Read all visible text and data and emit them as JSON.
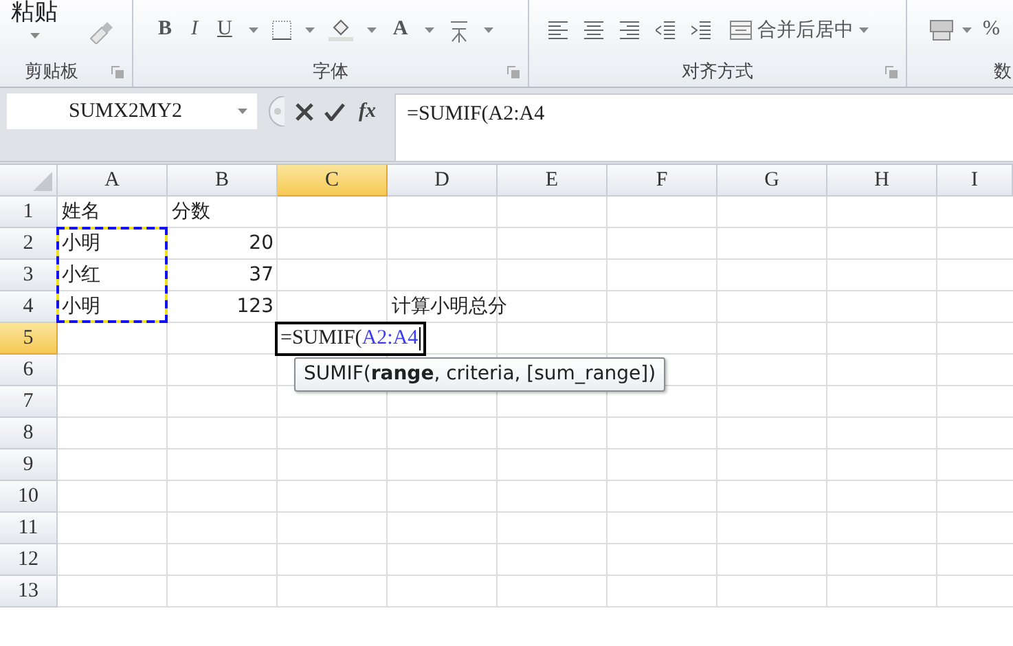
{
  "ribbon": {
    "clipboard": {
      "paste_label": "粘贴",
      "group_label": "剪贴板"
    },
    "font": {
      "bold": "B",
      "italic": "I",
      "underline": "U",
      "font_color": "A",
      "group_label": "字体"
    },
    "alignment": {
      "merge_label": "合并后居中",
      "group_label": "对齐方式"
    },
    "number": {
      "percent": "%",
      "group_label": "数"
    }
  },
  "formula_bar": {
    "name_box": "SUMX2MY2",
    "insert_function": "fx",
    "formula": {
      "prefix": "=SUMIF(",
      "ref": "A2:A4"
    }
  },
  "columns": [
    {
      "letter": "A",
      "selected": false
    },
    {
      "letter": "B",
      "selected": false
    },
    {
      "letter": "C",
      "selected": true
    },
    {
      "letter": "D",
      "selected": false
    },
    {
      "letter": "E",
      "selected": false
    },
    {
      "letter": "F",
      "selected": false
    },
    {
      "letter": "G",
      "selected": false
    },
    {
      "letter": "H",
      "selected": false
    },
    {
      "letter": "I",
      "selected": false
    }
  ],
  "rows": [
    {
      "number": "1",
      "selected": false,
      "A": {
        "kind": "text",
        "text": "姓名"
      },
      "B": {
        "kind": "text",
        "text": "分数"
      }
    },
    {
      "number": "2",
      "selected": false,
      "A": {
        "kind": "text",
        "text": "小明",
        "in_reference": true
      },
      "B": {
        "kind": "number",
        "text": "20"
      }
    },
    {
      "number": "3",
      "selected": false,
      "A": {
        "kind": "text",
        "text": "小红",
        "in_reference": true
      },
      "B": {
        "kind": "number",
        "text": "37"
      }
    },
    {
      "number": "4",
      "selected": false,
      "A": {
        "kind": "text",
        "text": "小明",
        "in_reference": true
      },
      "B": {
        "kind": "number",
        "text": "123"
      },
      "D": {
        "kind": "text",
        "text": "计算小明总分"
      }
    },
    {
      "number": "5",
      "selected": true,
      "C": {
        "kind": "editor",
        "prefix": "=SUMIF(",
        "ref": "A2:A4"
      }
    },
    {
      "number": "6",
      "selected": false
    },
    {
      "number": "7",
      "selected": false
    },
    {
      "number": "8",
      "selected": false
    },
    {
      "number": "9",
      "selected": false
    },
    {
      "number": "10",
      "selected": false
    },
    {
      "number": "11",
      "selected": false
    },
    {
      "number": "12",
      "selected": false
    },
    {
      "number": "13",
      "selected": false
    }
  ],
  "tooltip": "SUMIF(**range**, criteria, [sum_range])"
}
